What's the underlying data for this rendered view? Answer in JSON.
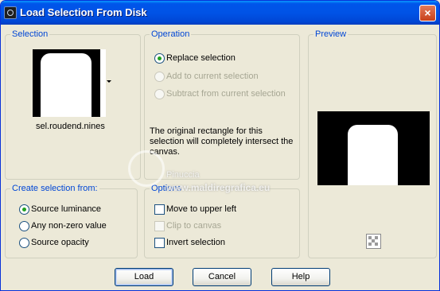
{
  "window": {
    "title": "Load Selection From Disk",
    "close_label": "×"
  },
  "selection": {
    "legend": "Selection",
    "filename": "sel.roudend.nines"
  },
  "operation": {
    "legend": "Operation",
    "options": [
      {
        "label": "Replace selection",
        "selected": true,
        "enabled": true
      },
      {
        "label": "Add to current selection",
        "selected": false,
        "enabled": false
      },
      {
        "label": "Subtract from current selection",
        "selected": false,
        "enabled": false
      }
    ],
    "info": "The original rectangle for this selection will completely intersect the canvas."
  },
  "preview": {
    "legend": "Preview"
  },
  "create_from": {
    "legend": "Create selection from:",
    "options": [
      {
        "label": "Source luminance",
        "selected": true
      },
      {
        "label": "Any non-zero value",
        "selected": false
      },
      {
        "label": "Source opacity",
        "selected": false
      }
    ]
  },
  "options": {
    "legend": "Options",
    "items": [
      {
        "label": "Move to upper left",
        "checked": false,
        "enabled": true
      },
      {
        "label": "Clip to canvas",
        "checked": false,
        "enabled": false
      },
      {
        "label": "Invert selection",
        "checked": false,
        "enabled": true
      }
    ]
  },
  "buttons": {
    "load": "Load",
    "cancel": "Cancel",
    "help": "Help"
  },
  "watermark": {
    "name": "Pinuccia",
    "site": "www.maldiregrafica.eu"
  }
}
